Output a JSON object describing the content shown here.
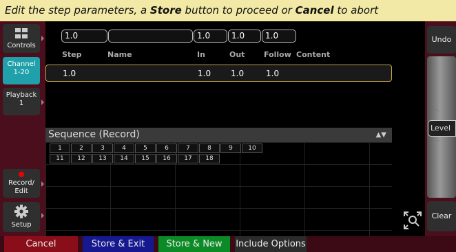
{
  "prompt": {
    "p1": "Edit the step parameters, a ",
    "store": "Store",
    "p2": " button to proceed or ",
    "cancel": "Cancel",
    "p3": " to abort"
  },
  "sidebar": {
    "controls": "Controls",
    "channel_l1": "Channel",
    "channel_l2": "1-20",
    "playback_l1": "Playback",
    "playback_l2": "1",
    "record_l1": "Record/",
    "record_l2": "Edit",
    "setup": "Setup"
  },
  "fields": {
    "step": "1.0",
    "name": "",
    "in": "1.0",
    "out": "1.0",
    "follow": "1.0"
  },
  "columns": [
    "Step",
    "Name",
    "In",
    "Out",
    "Follow",
    "Content"
  ],
  "row": {
    "step": "1.0",
    "in": "1.0",
    "out": "1.0",
    "follow": "1.0"
  },
  "sequence": {
    "title": "Sequence (Record)",
    "cells": [
      "1",
      "2",
      "3",
      "4",
      "5",
      "6",
      "7",
      "8",
      "9",
      "10",
      "11",
      "12",
      "13",
      "14",
      "15",
      "16",
      "17",
      "18"
    ]
  },
  "right_panel": {
    "undo": "Undo",
    "level": "Level",
    "clear": "Clear"
  },
  "bottom": {
    "cancel": "Cancel",
    "store_exit": "Store & Exit",
    "store_new": "Store & New",
    "include_options": "Include Options"
  },
  "colors": {
    "accent": "#20a0aa",
    "sidebar": "#4a0e1c",
    "prompt_bg": "#f2e9a6",
    "cancel": "#8a0e1a",
    "store_exit": "#16188f",
    "store_new": "#0c8a25"
  }
}
